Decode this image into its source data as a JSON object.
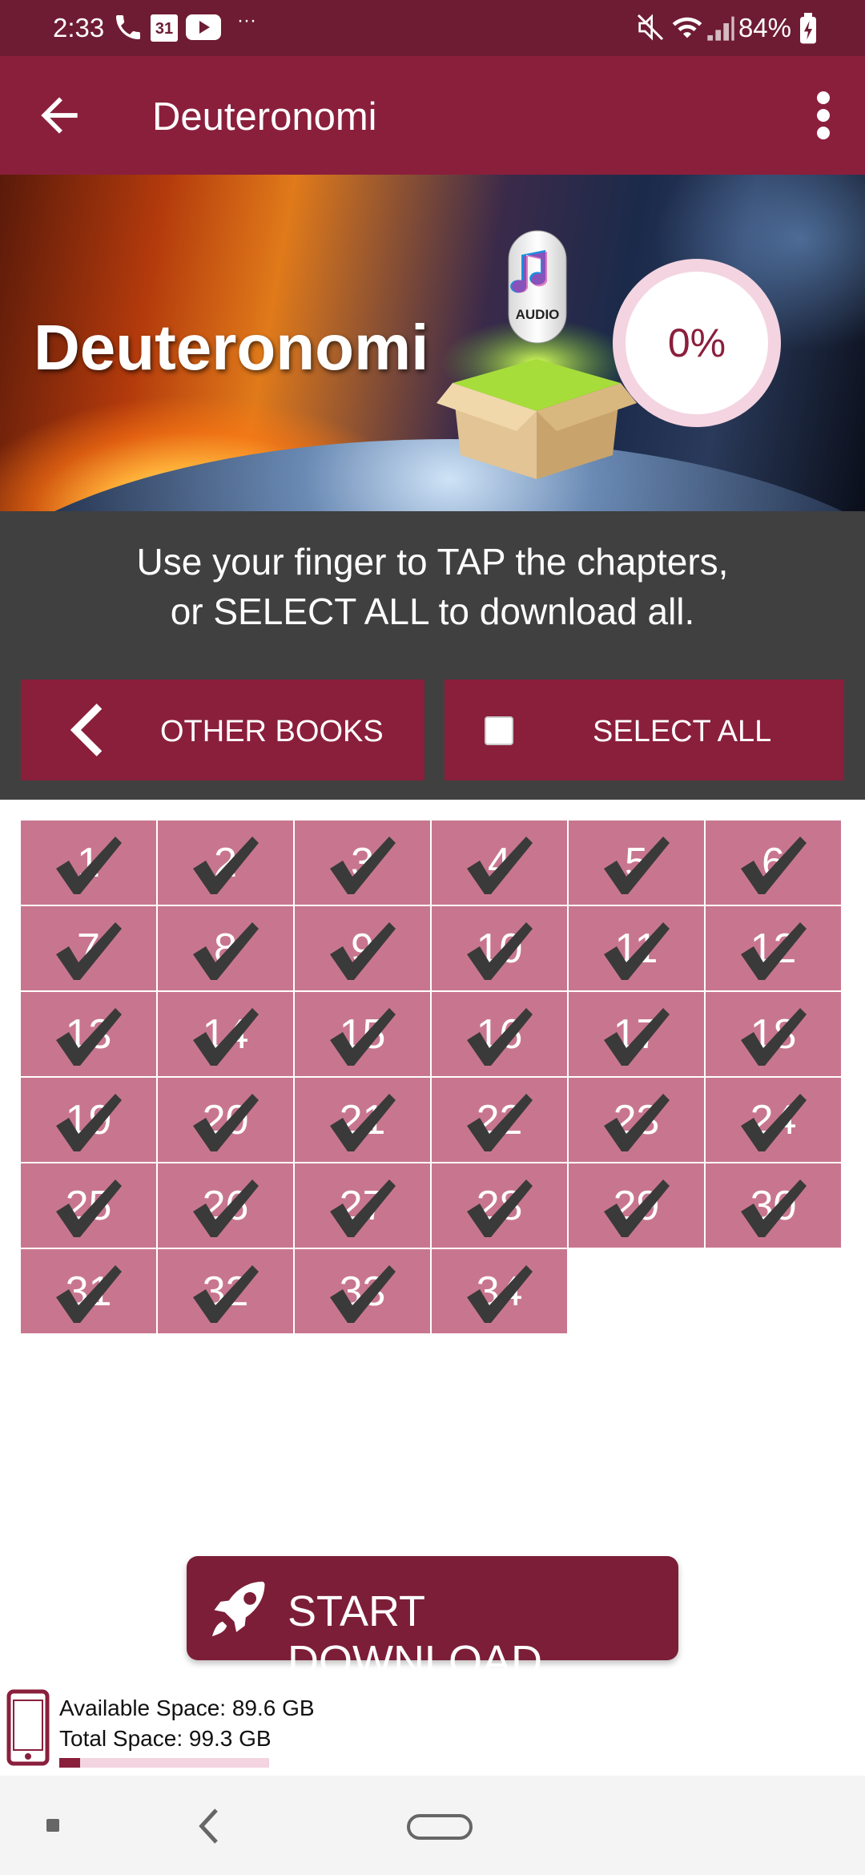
{
  "status_bar": {
    "time": "2:33",
    "battery_percent": "84%",
    "icons": [
      "phone-icon",
      "calendar-icon",
      "youtube-icon",
      "more-dots-icon",
      "mute-icon",
      "wifi-icon",
      "signal-icon",
      "battery-charging-icon"
    ],
    "calendar_day": "31"
  },
  "app_bar": {
    "title": "Deuteronomi",
    "back_icon": "arrow-back-icon",
    "menu_icon": "more-vert-icon"
  },
  "banner": {
    "book_title": "Deuteronomi",
    "audio_label": "AUDIO",
    "progress_text": "0%",
    "progress_value": 0
  },
  "instructions": {
    "line1": "Use your finger to TAP the chapters,",
    "line2": "or SELECT ALL to download all."
  },
  "buttons": {
    "other_books": "OTHER BOOKS",
    "select_all": "SELECT ALL",
    "select_all_checked": false,
    "start_download": "START DOWNLOAD"
  },
  "chapters": [
    "1",
    "2",
    "3",
    "4",
    "5",
    "6",
    "7",
    "8",
    "9",
    "10",
    "11",
    "12",
    "13",
    "14",
    "15",
    "16",
    "17",
    "18",
    "19",
    "20",
    "21",
    "22",
    "23",
    "24",
    "25",
    "26",
    "27",
    "28",
    "29",
    "30",
    "31",
    "32",
    "33",
    "34"
  ],
  "storage": {
    "available": "Available Space: 89.6 GB",
    "total": "Total Space: 99.3 GB",
    "used_fraction": 0.1
  },
  "colors": {
    "primary": "#8a1f3c",
    "status_bar": "#6e1c33",
    "chapter_cell": "#c8768f",
    "panel": "#404040",
    "progress_ring": "#f3d4e0"
  }
}
